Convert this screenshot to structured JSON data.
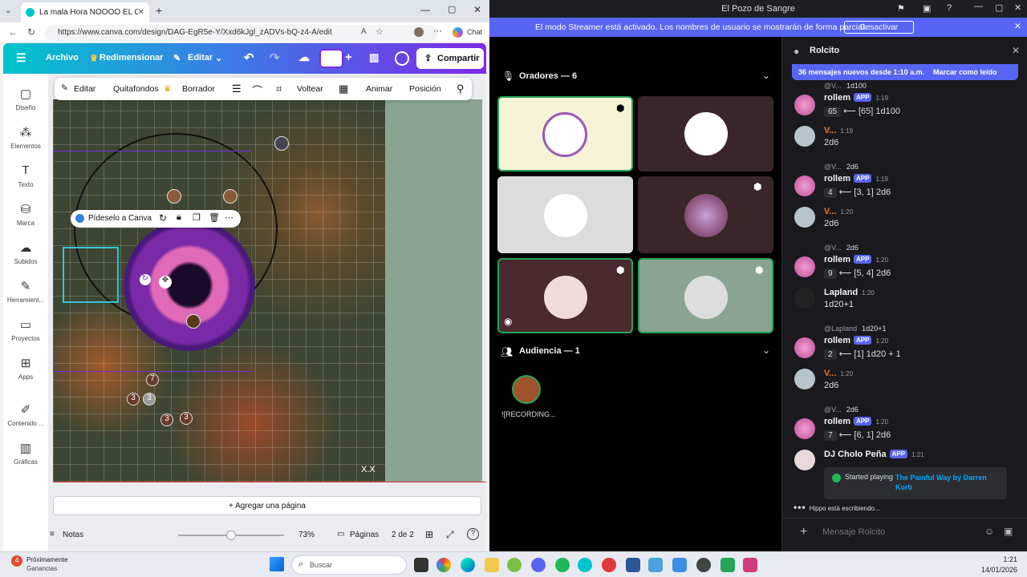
{
  "browser": {
    "tab_title": "La mala Hora NOOOO EL CROW M",
    "url": "https://www.canva.com/design/DAG-EgR5e-Y/Xxd6kJgl_zADVs-bQ-z4-A/edit",
    "chat_label": "Chat"
  },
  "canva": {
    "menu": {
      "file": "Archivo",
      "resize": "Redimensionar",
      "edit": "Editar",
      "share": "Compartir"
    },
    "sidebar": [
      "Diseño",
      "Elementos",
      "Texto",
      "Marca",
      "Subidos",
      "Herramient...",
      "Proyectos",
      "Apps",
      "Contenido ...",
      "Gráficas"
    ],
    "context_toolbar": {
      "edit": "Editar",
      "bg_remover": "Quitafondos",
      "eraser": "Borrador",
      "flip": "Voltear",
      "animate": "Animar",
      "position": "Posición"
    },
    "floating_toolbar": {
      "ask": "Pídeselo a Canva"
    },
    "map_label": "X.X",
    "token_numbers": [
      "7",
      "3",
      "3",
      "3",
      "3"
    ],
    "add_page": "+ Agregar una página",
    "notes": "Notas",
    "zoom": "73%",
    "pages_label": "Páginas",
    "pages_count": "2 de 2"
  },
  "discord": {
    "window_title": "El Pozo de Sangre",
    "streamer_banner": "El modo Streamer está activado. Los nombres de usuario se mostrarán de forma parcial.",
    "streamer_button": "Desactivar",
    "speakers_header": "Oradores — 6",
    "audience_header": "Audiencia — 1",
    "audience_user": "![RECORDING...",
    "chat": {
      "channel": "Rolcito",
      "new_messages": "36 mensajes nuevos desde 1:10 a.m.",
      "mark_read": "Marcar como leído",
      "typing": "Hippo está escribiendo...",
      "input_placeholder": "Mensaje Rolcito",
      "app_tag": "APP",
      "messages": [
        {
          "type": "bot",
          "reply_user": "@V...",
          "reply_text": "1d100",
          "name": "rollem",
          "time": "1:19",
          "dice": "65",
          "result": "⟵ [65] 1d100"
        },
        {
          "type": "user",
          "name": "V...",
          "time": "1:19",
          "text": "2d6"
        },
        {
          "type": "bot",
          "reply_user": "@V...",
          "reply_text": "2d6",
          "name": "rollem",
          "time": "1:19",
          "dice": "4",
          "result": "⟵ [3, 1] 2d6"
        },
        {
          "type": "user",
          "name": "V...",
          "time": "1:20",
          "text": "2d6"
        },
        {
          "type": "bot",
          "reply_user": "@V...",
          "reply_text": "2d6",
          "name": "rollem",
          "time": "1:20",
          "dice": "9",
          "result": "⟵ [5, 4] 2d6"
        },
        {
          "type": "user",
          "name": "Lapland",
          "time": "1:20",
          "text": "1d20+1"
        },
        {
          "type": "bot",
          "reply_user": "@Lapland",
          "reply_text": "1d20+1",
          "name": "rollem",
          "time": "1:20",
          "dice": "2",
          "result": "⟵ [1] 1d20 + 1"
        },
        {
          "type": "user",
          "name": "V...",
          "time": "1:20",
          "text": "2d6"
        },
        {
          "type": "bot",
          "reply_user": "@V...",
          "reply_text": "2d6",
          "name": "rollem",
          "time": "1:20",
          "dice": "7",
          "result": "⟵ [6, 1] 2d6"
        }
      ],
      "last": {
        "name": "DJ Cholo Peña",
        "time": "1:21",
        "started": "Started playing",
        "song": "The Painful Way by Darren Korb"
      }
    }
  },
  "taskbar": {
    "weather_count": "4",
    "weather_line1": "Próximamente",
    "weather_line2": "Ganancias",
    "search": "Buscar",
    "time": "1:21",
    "date": "14/01/2026"
  }
}
